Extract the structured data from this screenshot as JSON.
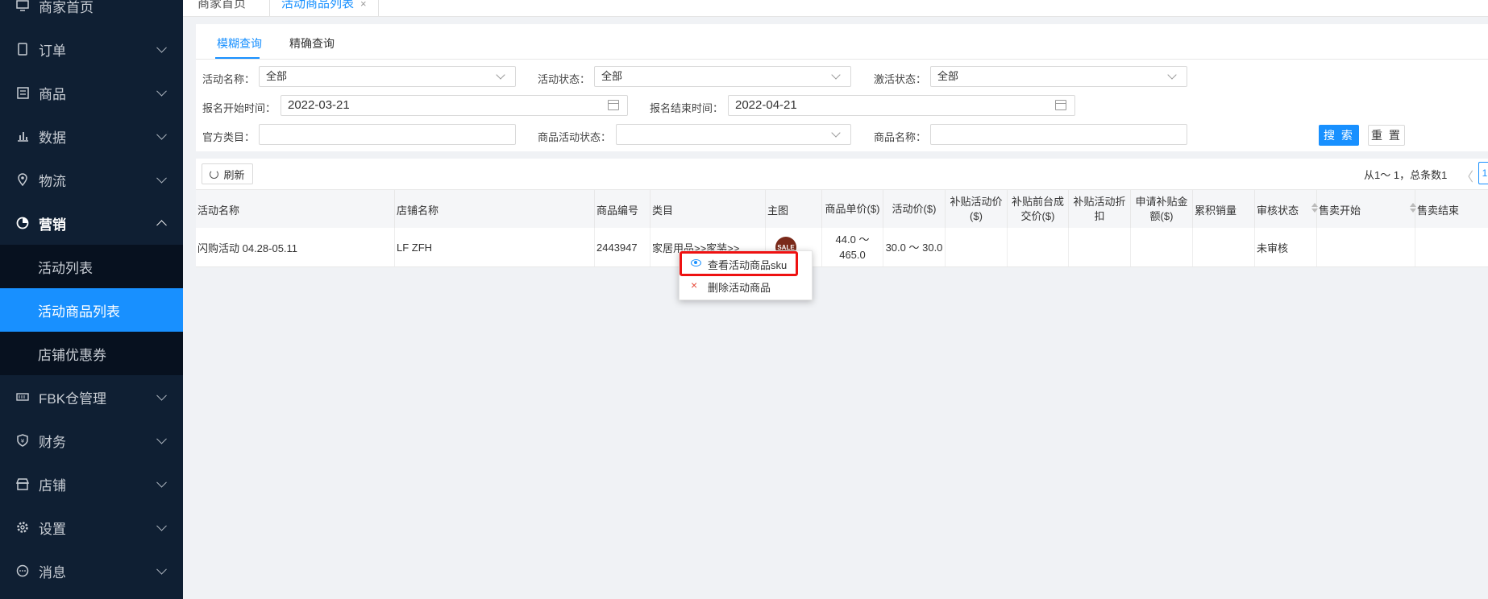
{
  "sidebar": {
    "home": "商家首页",
    "items": [
      {
        "label": "订单",
        "icon": "clipboard-icon"
      },
      {
        "label": "商品",
        "icon": "product-icon"
      },
      {
        "label": "数据",
        "icon": "bar-chart-icon"
      },
      {
        "label": "物流",
        "icon": "location-pin-icon"
      },
      {
        "label": "营销",
        "icon": "pie-chart-icon"
      },
      {
        "label": "FBK仓管理",
        "icon": "warehouse-icon"
      },
      {
        "label": "财务",
        "icon": "shield-money-icon"
      },
      {
        "label": "店铺",
        "icon": "store-icon"
      },
      {
        "label": "设置",
        "icon": "gear-icon"
      },
      {
        "label": "消息",
        "icon": "chat-icon"
      }
    ],
    "marketing_sub": [
      "活动列表",
      "活动商品列表",
      "店铺优惠券"
    ]
  },
  "tabs": {
    "home": "商家首页",
    "current": "活动商品列表",
    "close": "×"
  },
  "filter": {
    "subtabs": [
      "模糊查询",
      "精确查询"
    ],
    "activity_name_label": "活动名称：",
    "activity_name_value": "全部",
    "activity_status_label": "活动状态：",
    "activity_status_value": "全部",
    "activation_status_label": "激活状态：",
    "activation_status_value": "全部",
    "signup_start_label": "报名开始时间：",
    "signup_start_value": "2022-03-21",
    "signup_end_label": "报名结束时间：",
    "signup_end_value": "2022-04-21",
    "official_category_label": "官方类目：",
    "product_activity_status_label": "商品活动状态：",
    "product_name_label": "商品名称：",
    "search_button": "搜 索",
    "reset_button": "重 置"
  },
  "toolbar": {
    "refresh": "刷新",
    "pagination": "从1～ 1，总条数1",
    "prev": "〈",
    "page": "1"
  },
  "table": {
    "headers": [
      "活动名称",
      "店铺名称",
      "商品编号",
      "类目",
      "主图",
      "商品单价($)",
      "活动价($)",
      "补贴活动价($)",
      "补贴前台成交价($)",
      "补贴活动折扣",
      "申请补贴金额($)",
      "累积销量",
      "审核状态",
      "售卖开始",
      "售卖结束"
    ],
    "rows": [
      {
        "activity_name": "闪购活动 04.28-05.11",
        "store_name": "LF ZFH",
        "product_id": "2443947",
        "category": "家居用品>>家装>>...",
        "image_label": "SALE",
        "unit_price": "44.0 ～ 465.0",
        "activity_price": "30.0 ～ 30.0",
        "subsidy_price": "",
        "subsidy_front_price": "",
        "subsidy_discount": "",
        "subsidy_amount": "",
        "sales": "",
        "review_status": "未审核",
        "sale_start": "",
        "sale_end": ""
      }
    ]
  },
  "context_menu": {
    "view_sku": "查看活动商品sku",
    "delete": "删除活动商品"
  },
  "colors": {
    "sidebar_bg": "#0f1f33",
    "accent": "#1890ff",
    "highlight": "#ee1111"
  }
}
